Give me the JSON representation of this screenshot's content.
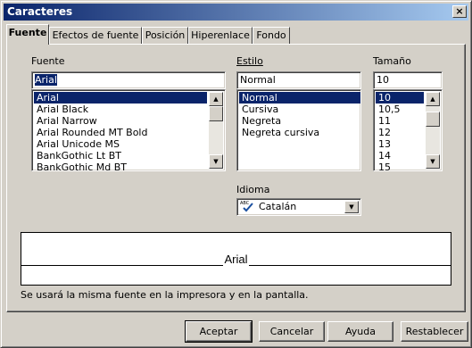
{
  "window": {
    "title": "Caracteres",
    "close_glyph": "×"
  },
  "tabs": [
    {
      "label": "Fuente",
      "active": true
    },
    {
      "label": "Efectos de fuente",
      "active": false
    },
    {
      "label": "Posición",
      "active": false
    },
    {
      "label": "Hiperenlace",
      "active": false
    },
    {
      "label": "Fondo",
      "active": false
    }
  ],
  "font": {
    "label": "Fuente",
    "value": "Arial",
    "items": [
      "Arial",
      "Arial Black",
      "Arial Narrow",
      "Arial Rounded MT Bold",
      "Arial Unicode MS",
      "BankGothic Lt BT",
      "BankGothic Md BT"
    ],
    "selected_index": 0
  },
  "style": {
    "label": "Estilo",
    "value": "Normal",
    "items": [
      "Normal",
      "Cursiva",
      "Negreta",
      "Negreta cursiva"
    ],
    "selected_index": 0
  },
  "size": {
    "label": "Tamaño",
    "value": "10",
    "items": [
      "10",
      "10,5",
      "11",
      "12",
      "13",
      "14",
      "15"
    ],
    "selected_index": 0
  },
  "language": {
    "label": "Idioma",
    "value": "Catalán",
    "spell_icon_text": "ABC",
    "icon": "spellcheck-icon"
  },
  "preview": {
    "text": "Arial"
  },
  "info_text": "Se usará la misma fuente en la impresora y en la pantalla.",
  "buttons": {
    "ok": "Aceptar",
    "cancel": "Cancelar",
    "help": "Ayuda",
    "reset": "Restablecer"
  },
  "colors": {
    "title_start": "#0a246a",
    "title_end": "#a6caf0",
    "selection": "#0a246a",
    "face": "#d4d0c8"
  },
  "icons": {
    "scroll_up": "▲",
    "scroll_down": "▼",
    "dropdown": "▼"
  }
}
